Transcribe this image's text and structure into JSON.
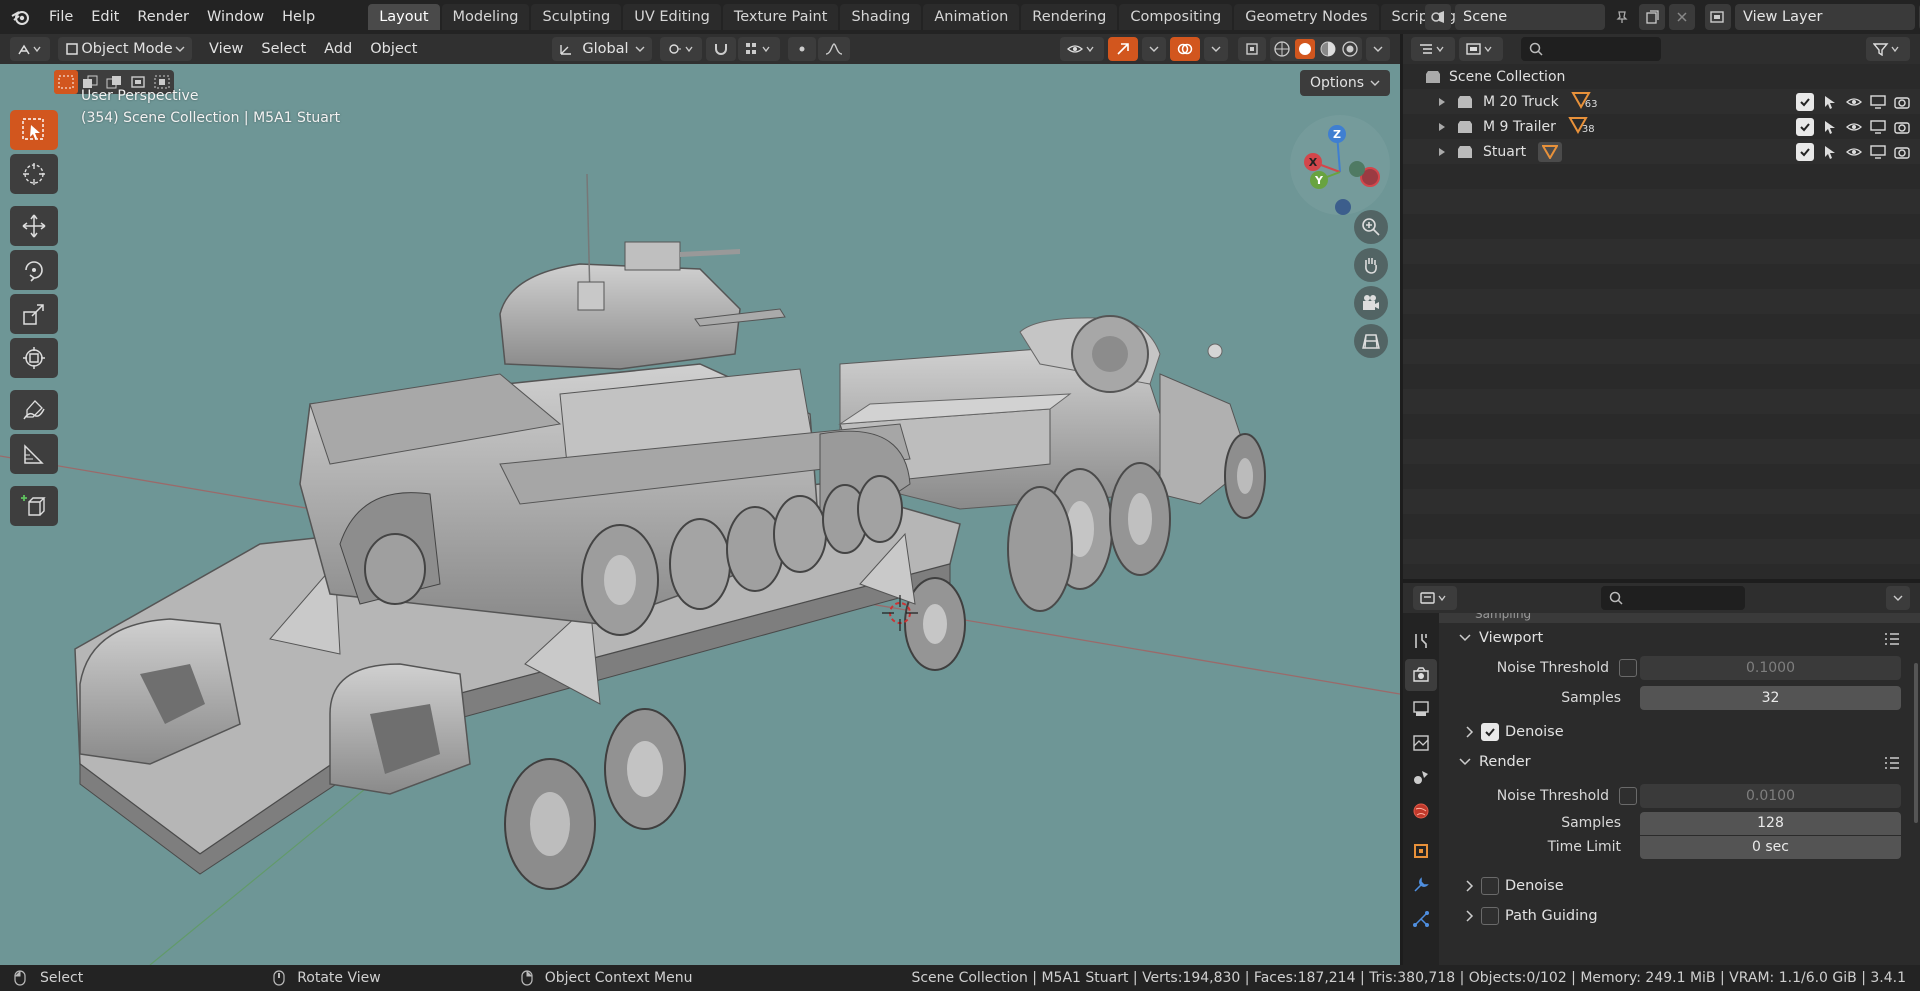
{
  "menus": [
    "File",
    "Edit",
    "Render",
    "Window",
    "Help"
  ],
  "workspaces": [
    {
      "label": "Layout",
      "active": true
    },
    {
      "label": "Modeling"
    },
    {
      "label": "Sculpting"
    },
    {
      "label": "UV Editing"
    },
    {
      "label": "Texture Paint"
    },
    {
      "label": "Shading"
    },
    {
      "label": "Animation"
    },
    {
      "label": "Rendering"
    },
    {
      "label": "Compositing"
    },
    {
      "label": "Geometry Nodes"
    },
    {
      "label": "Scripting"
    }
  ],
  "scene": {
    "name": "Scene",
    "view_layer": "View Layer"
  },
  "viewport_header": {
    "mode": "Object Mode",
    "menus": [
      "View",
      "Select",
      "Add",
      "Object"
    ],
    "transform_orientation": "Global"
  },
  "viewport": {
    "perspective": "User Perspective",
    "context": "(354) Scene Collection | M5A1 Stuart",
    "options_label": "Options",
    "gizmo": {
      "x": "X",
      "y": "Y",
      "z": "Z"
    },
    "colors": {
      "background": "#6e9696",
      "active_tool": "#d2561e",
      "x_axis": "#d3464b",
      "y_axis": "#68a340",
      "z_axis": "#3f7fd1"
    }
  },
  "outliner": {
    "root": "Scene Collection",
    "items": [
      {
        "name": "M 20 Truck",
        "count": "63"
      },
      {
        "name": "M 9 Trailer",
        "count": "38"
      },
      {
        "name": "Stuart",
        "count": ""
      }
    ]
  },
  "properties": {
    "section_cutoff": "Sampling",
    "viewport_panel": {
      "title": "Viewport",
      "noise_threshold_label": "Noise Threshold",
      "noise_threshold_value": "0.1000",
      "samples_label": "Samples",
      "samples_value": "32",
      "denoise_label": "Denoise",
      "denoise_checked": true
    },
    "render_panel": {
      "title": "Render",
      "noise_threshold_label": "Noise Threshold",
      "noise_threshold_value": "0.0100",
      "samples_label": "Samples",
      "samples_value": "128",
      "time_limit_label": "Time Limit",
      "time_limit_value": "0 sec",
      "denoise_label": "Denoise",
      "denoise_checked": false,
      "path_guiding_label": "Path Guiding"
    }
  },
  "statusbar": {
    "select": "Select",
    "rotate": "Rotate View",
    "context_menu": "Object Context Menu",
    "stats": "Scene Collection | M5A1 Stuart | Verts:194,830 | Faces:187,214 | Tris:380,718 | Objects:0/102 | Memory: 249.1 MiB | VRAM: 1.1/6.0 GiB | 3.4.1"
  }
}
